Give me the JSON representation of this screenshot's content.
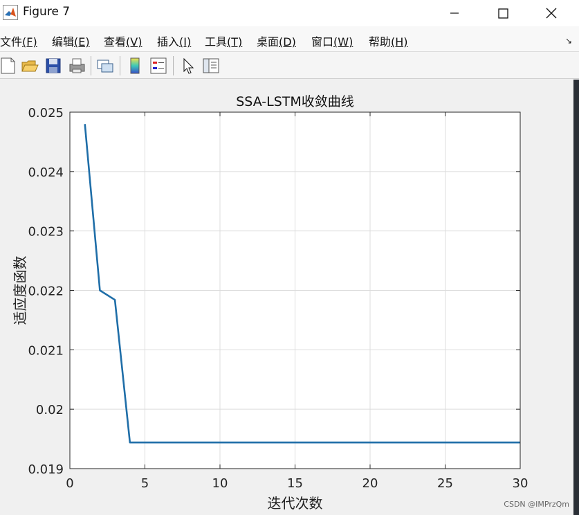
{
  "window": {
    "title": "Figure 7",
    "icon": "matlab-icon",
    "controls": [
      "minimize-icon",
      "maximize-icon",
      "close-icon"
    ]
  },
  "menubar": {
    "items": [
      {
        "label": "文件",
        "key": "(F)"
      },
      {
        "label": "编辑",
        "key": "(E)"
      },
      {
        "label": "查看",
        "key": "(V)"
      },
      {
        "label": "插入",
        "key": "(I)"
      },
      {
        "label": "工具",
        "key": "(T)"
      },
      {
        "label": "桌面",
        "key": "(D)"
      },
      {
        "label": "窗口",
        "key": "(W)"
      },
      {
        "label": "帮助",
        "key": "(H)"
      }
    ],
    "dock_icon": "↘"
  },
  "toolbar": {
    "icons": [
      "new-figure-icon",
      "open-file-icon",
      "save-icon",
      "print-icon",
      "link-icon",
      "colorbar-icon",
      "legend-icon",
      "pointer-icon",
      "property-editor-icon"
    ]
  },
  "chart_data": {
    "type": "line",
    "title": "SSA-LSTM收敛曲线",
    "xlabel": "迭代次数",
    "ylabel": "适应度函数",
    "xlim": [
      0,
      30
    ],
    "ylim": [
      0.019,
      0.025
    ],
    "xticks": [
      0,
      5,
      10,
      15,
      20,
      25,
      30
    ],
    "yticks": [
      0.019,
      0.02,
      0.021,
      0.022,
      0.023,
      0.024,
      0.025
    ],
    "ytick_labels": [
      "0.019",
      "0.02",
      "0.021",
      "0.022",
      "0.023",
      "0.024",
      "0.025"
    ],
    "grid": true,
    "line_color": "#1f6ea8",
    "x": [
      1,
      2,
      3,
      4,
      5,
      6,
      7,
      8,
      9,
      10,
      11,
      12,
      13,
      14,
      15,
      16,
      17,
      18,
      19,
      20,
      21,
      22,
      23,
      24,
      25,
      26,
      27,
      28,
      29,
      30
    ],
    "y": [
      0.0248,
      0.022,
      0.02184,
      0.01944,
      0.01944,
      0.01944,
      0.01944,
      0.01944,
      0.01944,
      0.01944,
      0.01944,
      0.01944,
      0.01944,
      0.01944,
      0.01944,
      0.01944,
      0.01944,
      0.01944,
      0.01944,
      0.01944,
      0.01944,
      0.01944,
      0.01944,
      0.01944,
      0.01944,
      0.01944,
      0.01944,
      0.01944,
      0.01944,
      0.01944
    ]
  },
  "watermark": "CSDN @IMPrzQm"
}
